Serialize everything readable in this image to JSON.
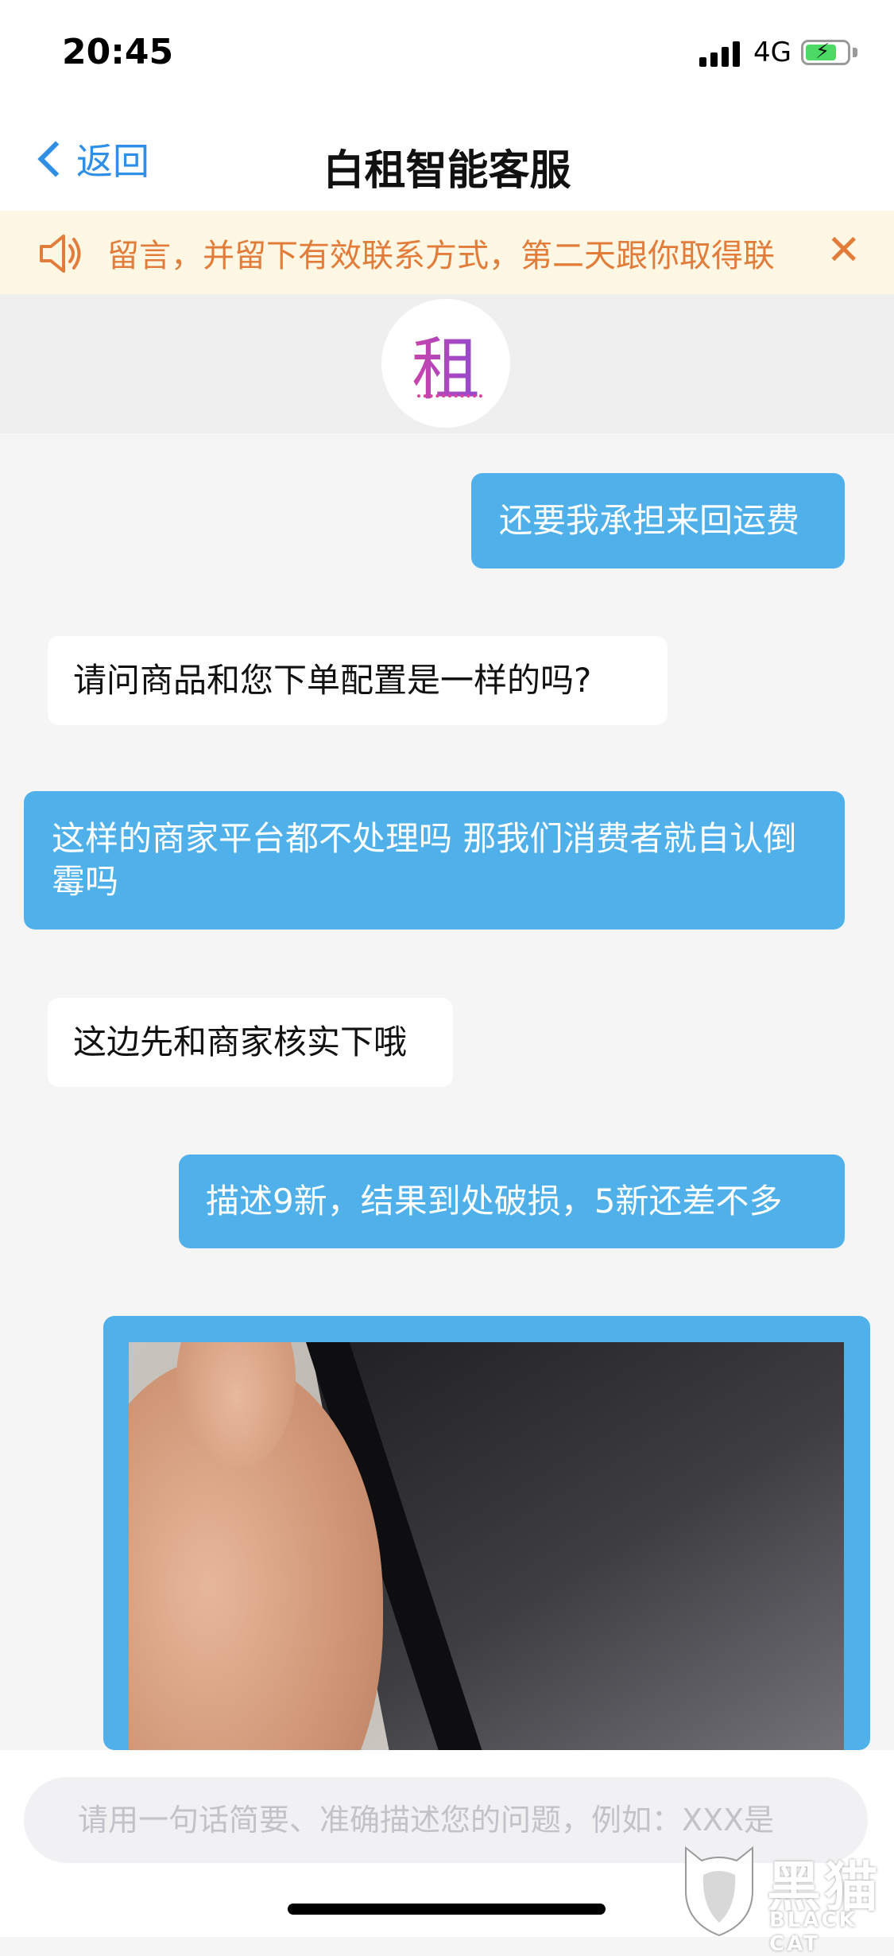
{
  "status_bar": {
    "time": "20:45",
    "network": "4G",
    "battery_level": 0.75,
    "battery_color": "#4cd964"
  },
  "nav": {
    "back_label": "返回",
    "title": "白租智能客服"
  },
  "notice": {
    "text": "留言，并留下有效联系方式，第二天跟你取得联",
    "close_glyph": "✕",
    "color": "#e27c3a"
  },
  "agent": {
    "avatar_glyph": "租"
  },
  "messages": [
    {
      "side": "right",
      "text": "还要我承担来回运费"
    },
    {
      "side": "left",
      "text": "请问商品和您下单配置是一样的吗?"
    },
    {
      "side": "right",
      "text": "这样的商家平台都不处理吗 那我们消费者就自认倒霉吗"
    },
    {
      "side": "left",
      "text": "这边先和商家核实下哦"
    },
    {
      "side": "right",
      "text": "描述9新，结果到处破损，5新还差不多"
    },
    {
      "side": "right",
      "type": "image"
    }
  ],
  "input": {
    "placeholder": "请用一句话简要、准确描述您的问题，例如：XXX是"
  },
  "watermark": {
    "title": "黑猫",
    "subtitle": "BLACK CAT"
  },
  "colors": {
    "accent": "#2f8fe6",
    "bubble_right": "#4fb0ea",
    "bubble_left": "#ffffff"
  }
}
